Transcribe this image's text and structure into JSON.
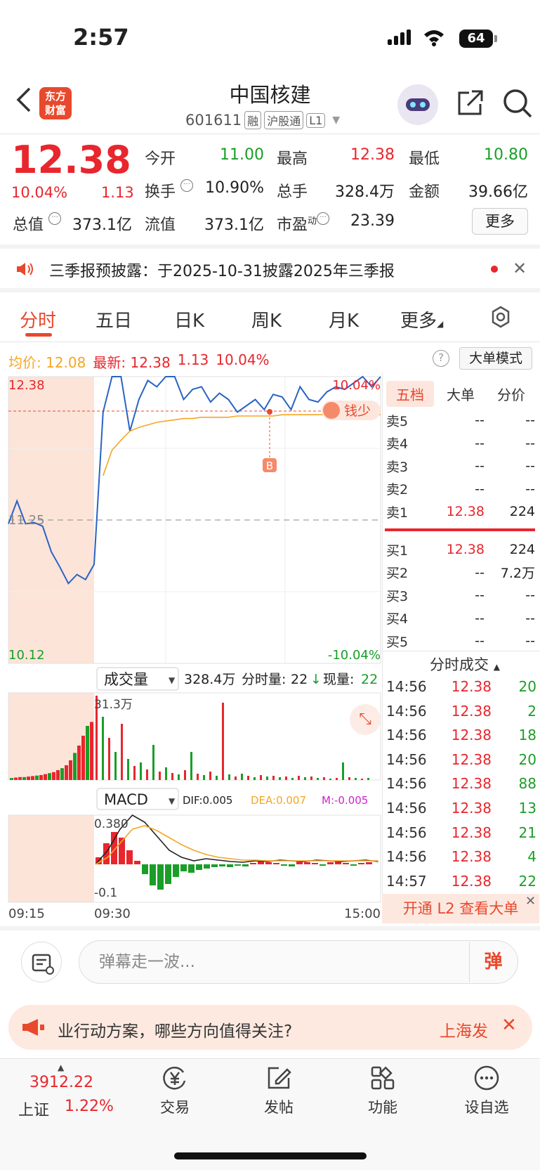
{
  "status": {
    "time": "2:57",
    "battery": "64"
  },
  "header": {
    "logo_line1": "东方",
    "logo_line2": "财富",
    "name": "中国核建",
    "code": "601611",
    "tags": [
      "融",
      "沪股通",
      "L1"
    ]
  },
  "quote": {
    "price": "12.38",
    "pct": "10.04%",
    "change": "1.13",
    "open_label": "今开",
    "open": "11.00",
    "high_label": "最高",
    "high": "12.38",
    "low_label": "最低",
    "low": "10.80",
    "turnover_label": "换手",
    "turnover": "10.90%",
    "volume_label": "总手",
    "volume": "328.4万",
    "amount_label": "金额",
    "amount": "39.66亿",
    "mktcap_label": "总值",
    "mktcap": "373.1亿",
    "float_label": "流值",
    "float": "373.1亿",
    "pe_label": "市盈",
    "pe_sup": "动",
    "pe": "23.39",
    "more": "更多"
  },
  "announcement": {
    "text": "三季报预披露：于2025-10-31披露2025年三季报"
  },
  "tabs": [
    "分时",
    "五日",
    "日K",
    "周K",
    "月K",
    "更多"
  ],
  "chart_info": {
    "avg_label": "均价:",
    "avg": "12.08",
    "last_label": "最新:",
    "last": "12.38",
    "chg": "1.13",
    "pct": "10.04%",
    "mode_button": "大单模式"
  },
  "chart_data": {
    "type": "line",
    "price_axis": {
      "top": "12.38",
      "mid": "11.25",
      "bottom": "10.12",
      "top_pct": "10.04%",
      "bottom_pct": "-10.04%"
    },
    "time_axis": [
      "09:15",
      "09:30",
      "15:00"
    ],
    "marker_label": "B",
    "badge_label": "钱少",
    "series": [
      {
        "values": [
          11.22,
          11.4,
          11.22,
          11.23,
          11.2,
          11.0,
          10.88,
          10.75,
          10.82,
          10.78,
          10.9,
          12.1,
          12.38,
          12.38,
          11.95,
          12.2,
          12.35,
          12.3,
          12.38,
          12.38,
          12.2,
          12.28,
          12.3,
          12.18,
          12.25,
          12.2,
          12.1,
          12.15,
          12.2,
          12.12,
          12.24,
          12.22,
          12.12,
          12.3,
          12.2,
          12.18,
          12.26,
          12.3,
          12.28,
          12.33,
          12.38,
          12.3,
          12.38
        ]
      },
      {
        "values": [
          null,
          null,
          null,
          null,
          null,
          null,
          null,
          null,
          null,
          null,
          null,
          11.6,
          11.8,
          11.88,
          11.95,
          11.98,
          12.0,
          12.02,
          12.03,
          12.04,
          12.05,
          12.05,
          12.06,
          12.06,
          12.06,
          12.06,
          12.07,
          12.07,
          12.07,
          12.07,
          12.07,
          12.08,
          12.08,
          12.08,
          12.08,
          12.08,
          12.08,
          12.08,
          12.08,
          12.08,
          12.08,
          12.08,
          12.08
        ]
      }
    ],
    "volume": {
      "label": "成交量",
      "total": "328.4万",
      "minute_label": "分时量:",
      "minute": "22",
      "now_label": "现量:",
      "now": "22",
      "max_label": "31.3万"
    },
    "macd": {
      "label": "MACD",
      "dif": "DIF:0.005",
      "dea": "DEA:0.007",
      "m": "M:-0.005",
      "top_label": "0.380",
      "bottom_label": "-0.1"
    }
  },
  "order_book": {
    "tabs": [
      "五档",
      "大单",
      "分价"
    ],
    "asks": [
      {
        "label": "卖5",
        "price": "--",
        "vol": "--"
      },
      {
        "label": "卖4",
        "price": "--",
        "vol": "--"
      },
      {
        "label": "卖3",
        "price": "--",
        "vol": "--"
      },
      {
        "label": "卖2",
        "price": "--",
        "vol": "--"
      },
      {
        "label": "卖1",
        "price": "12.38",
        "vol": "224"
      }
    ],
    "bids": [
      {
        "label": "买1",
        "price": "12.38",
        "vol": "224"
      },
      {
        "label": "买2",
        "price": "--",
        "vol": "7.2万"
      },
      {
        "label": "买3",
        "price": "--",
        "vol": "--"
      },
      {
        "label": "买4",
        "price": "--",
        "vol": "--"
      },
      {
        "label": "买5",
        "price": "--",
        "vol": "--"
      }
    ]
  },
  "trades": {
    "title": "分时成交",
    "rows": [
      {
        "time": "14:56",
        "price": "12.38",
        "vol": "20"
      },
      {
        "time": "14:56",
        "price": "12.38",
        "vol": "2"
      },
      {
        "time": "14:56",
        "price": "12.38",
        "vol": "18"
      },
      {
        "time": "14:56",
        "price": "12.38",
        "vol": "20"
      },
      {
        "time": "14:56",
        "price": "12.38",
        "vol": "88"
      },
      {
        "time": "14:56",
        "price": "12.38",
        "vol": "13"
      },
      {
        "time": "14:56",
        "price": "12.38",
        "vol": "21"
      },
      {
        "time": "14:56",
        "price": "12.38",
        "vol": "4"
      },
      {
        "time": "14:57",
        "price": "12.38",
        "vol": "22"
      }
    ],
    "l2_banner": "开通 L2 查看大单"
  },
  "comment": {
    "placeholder": "弹幕走一波...",
    "danmu": "弹"
  },
  "ticker": {
    "text": "业行动方案，哪些方向值得关注?",
    "source": "上海发"
  },
  "bottom_nav": {
    "index_value": "3912.22",
    "index_name": "上证",
    "index_pct": "1.22%",
    "items": [
      "交易",
      "发帖",
      "功能",
      "设自选"
    ]
  },
  "colors": {
    "up": "#e8262d",
    "down": "#1a9e28",
    "accent": "#e8492d",
    "avg": "#f5a623",
    "price_line": "#2a63c4"
  }
}
